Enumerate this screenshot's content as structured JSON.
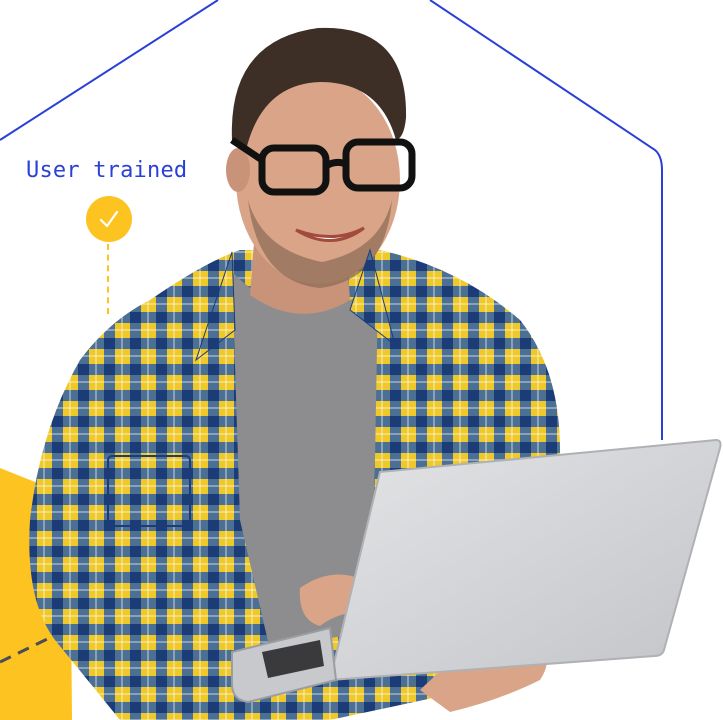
{
  "callout": {
    "label": "User trained",
    "icon": "check-icon"
  },
  "colors": {
    "accent_blue": "#2a40d6",
    "accent_yellow": "#fcc321",
    "dashed_gray": "#4c4c54",
    "shirt_blue": "#2f5fa7",
    "shirt_yellow": "#efc82a",
    "tshirt_gray": "#8d8d8f",
    "laptop_silver": "#d6d7da",
    "skin": "#d9a487",
    "hair": "#3e2f26"
  }
}
